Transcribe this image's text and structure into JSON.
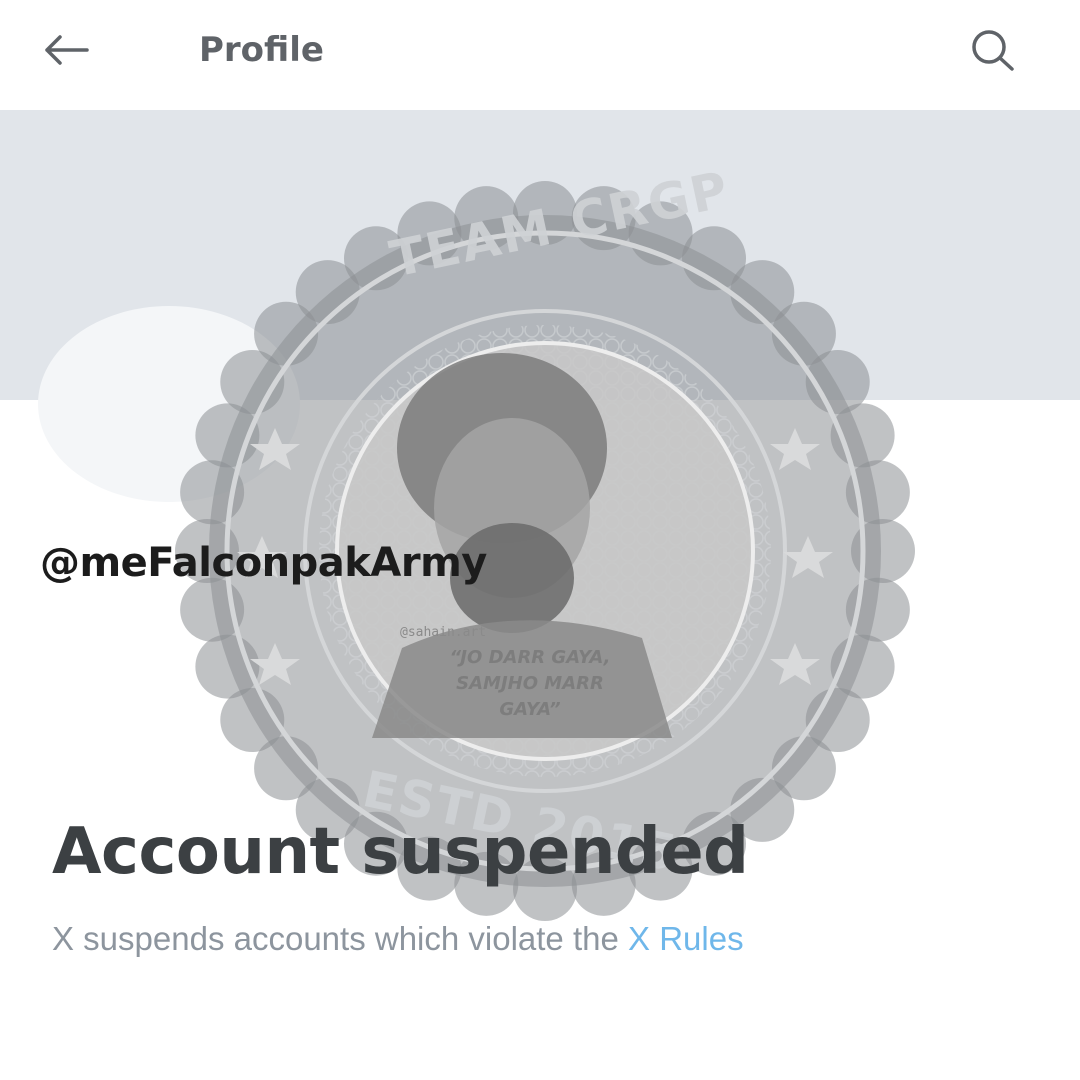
{
  "header": {
    "title": "Profile",
    "back_icon": "arrow-left-icon",
    "search_icon": "search-icon"
  },
  "profile": {
    "handle": "@meFalconpakArmy"
  },
  "suspension": {
    "title": "Account suspended",
    "description": "X suspends accounts which violate the ",
    "rules_link": "X Rules"
  },
  "watermark": {
    "top_text": "TEAM CRGP",
    "bottom_text": "ESTD 2015",
    "credit": "@sahain.art",
    "quote_line1": "“JO DARR GAYA,",
    "quote_line2": "SAMJHO MARR",
    "quote_line3": "GAYA”"
  },
  "colors": {
    "banner": "#e1e5ea",
    "link": "#6fb7ea",
    "seal": "#8c8f93"
  }
}
